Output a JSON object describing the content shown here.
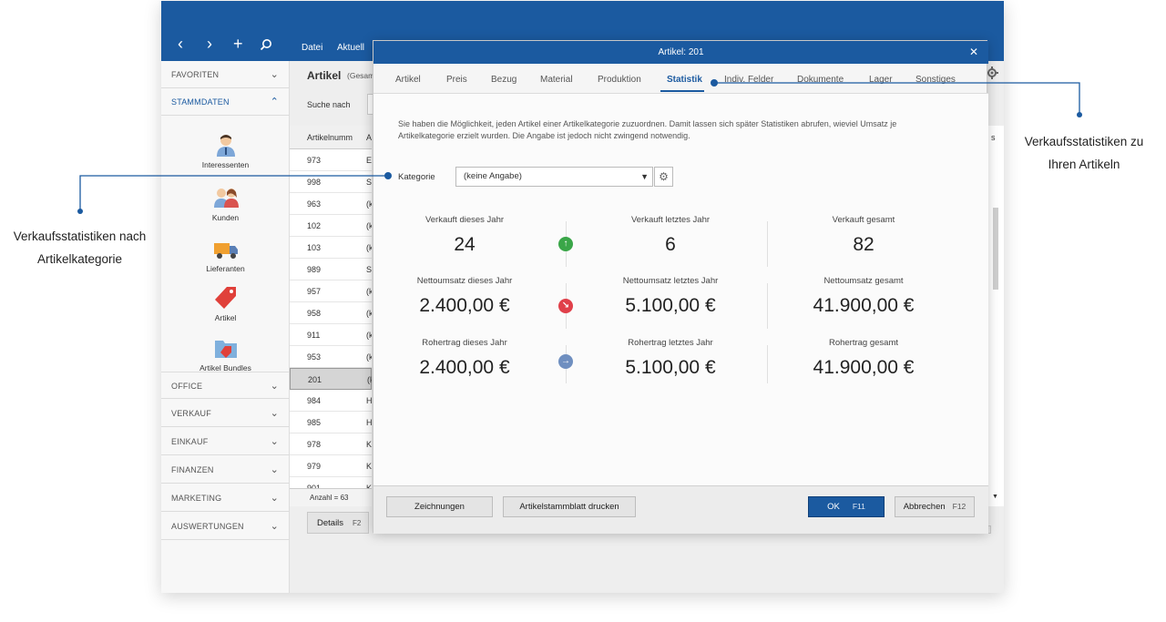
{
  "nav": {
    "back": "‹",
    "forward": "›",
    "add": "+",
    "search_icon": "search-icon"
  },
  "menu": {
    "datei": "Datei",
    "aktuell": "Aktuell"
  },
  "sidebar": {
    "favoriten": "FAVORITEN",
    "stammdaten": "STAMMDATEN",
    "items": [
      {
        "label": "Interessenten",
        "icon": "person-icon"
      },
      {
        "label": "Kunden",
        "icon": "customers-icon"
      },
      {
        "label": "Lieferanten",
        "icon": "truck-icon"
      },
      {
        "label": "Artikel",
        "icon": "tag-icon"
      },
      {
        "label": "Artikel Bundles",
        "icon": "folder-tag-icon"
      }
    ],
    "sections": [
      "OFFICE",
      "VERKAUF",
      "EINKAUF",
      "FINANZEN",
      "MARKETING",
      "AUSWERTUNGEN"
    ]
  },
  "list": {
    "title": "Artikel",
    "title_suffix": "(Gesam",
    "search_label": "Suche nach",
    "col_header": "Artikelnumm",
    "col2_header": "A",
    "rows": [
      {
        "num": "973",
        "c2": "E"
      },
      {
        "num": "998",
        "c2": "S"
      },
      {
        "num": "963",
        "c2": "(k"
      },
      {
        "num": "102",
        "c2": "(k"
      },
      {
        "num": "103",
        "c2": "(k"
      },
      {
        "num": "989",
        "c2": "S"
      },
      {
        "num": "957",
        "c2": "(k"
      },
      {
        "num": "958",
        "c2": "(k"
      },
      {
        "num": "911",
        "c2": "(k"
      },
      {
        "num": "953",
        "c2": "(k"
      },
      {
        "num": "201",
        "c2": "(k"
      },
      {
        "num": "984",
        "c2": "H"
      },
      {
        "num": "985",
        "c2": "H"
      },
      {
        "num": "978",
        "c2": "K"
      },
      {
        "num": "979",
        "c2": "K"
      },
      {
        "num": "901",
        "c2": "K"
      }
    ],
    "count": "Anzahl = 63",
    "details_button": "Details",
    "details_key": "F2",
    "right_header_fragment": "s"
  },
  "dialog": {
    "title": "Artikel: 201",
    "close": "✕",
    "tabs": [
      "Artikel",
      "Preis",
      "Bezug",
      "Material",
      "Produktion",
      "Statistik",
      "Indiv. Felder",
      "Dokumente",
      "Lager",
      "Sonstiges"
    ],
    "active_tab": "Statistik",
    "description": "Sie haben die Möglichkeit, jeden Artikel einer Artikelkategorie zuzuordnen. Damit lassen sich später Statistiken abrufen, wieviel Umsatz je Artikelkategorie erzielt wurden. Die Angabe ist jedoch nicht zwingend notwendig.",
    "kategorie_label": "Kategorie",
    "kategorie_value": "(keine Angabe)",
    "stats": {
      "sold_this_year_label": "Verkauft dieses Jahr",
      "sold_this_year": "24",
      "sold_last_year_label": "Verkauft letztes Jahr",
      "sold_last_year": "6",
      "sold_total_label": "Verkauft gesamt",
      "sold_total": "82",
      "net_this_year_label": "Nettoumsatz dieses Jahr",
      "net_this_year": "2.400,00 €",
      "net_last_year_label": "Nettoumsatz letztes Jahr",
      "net_last_year": "5.100,00 €",
      "net_total_label": "Nettoumsatz gesamt",
      "net_total": "41.900,00 €",
      "gross_this_year_label": "Rohertrag dieses Jahr",
      "gross_this_year": "2.400,00 €",
      "gross_last_year_label": "Rohertrag letztes Jahr",
      "gross_last_year": "5.100,00 €",
      "gross_total_label": "Rohertrag gesamt",
      "gross_total": "41.900,00 €"
    },
    "trend_colors": {
      "up": "#3aa648",
      "down": "#e0404a",
      "neutral": "#6f8fc0"
    },
    "footer": {
      "zeichnungen": "Zeichnungen",
      "stammblatt": "Artikelstammblatt drucken",
      "ok": "OK",
      "ok_key": "F11",
      "abbrechen": "Abbrechen",
      "abbrechen_key": "F12"
    }
  },
  "callouts": {
    "left": "Verkaufsstatistiken nach Artikelkategorie",
    "right": "Verkaufsstatistiken zu Ihren Artikeln"
  },
  "colors": {
    "accent": "#1b5aa0"
  }
}
